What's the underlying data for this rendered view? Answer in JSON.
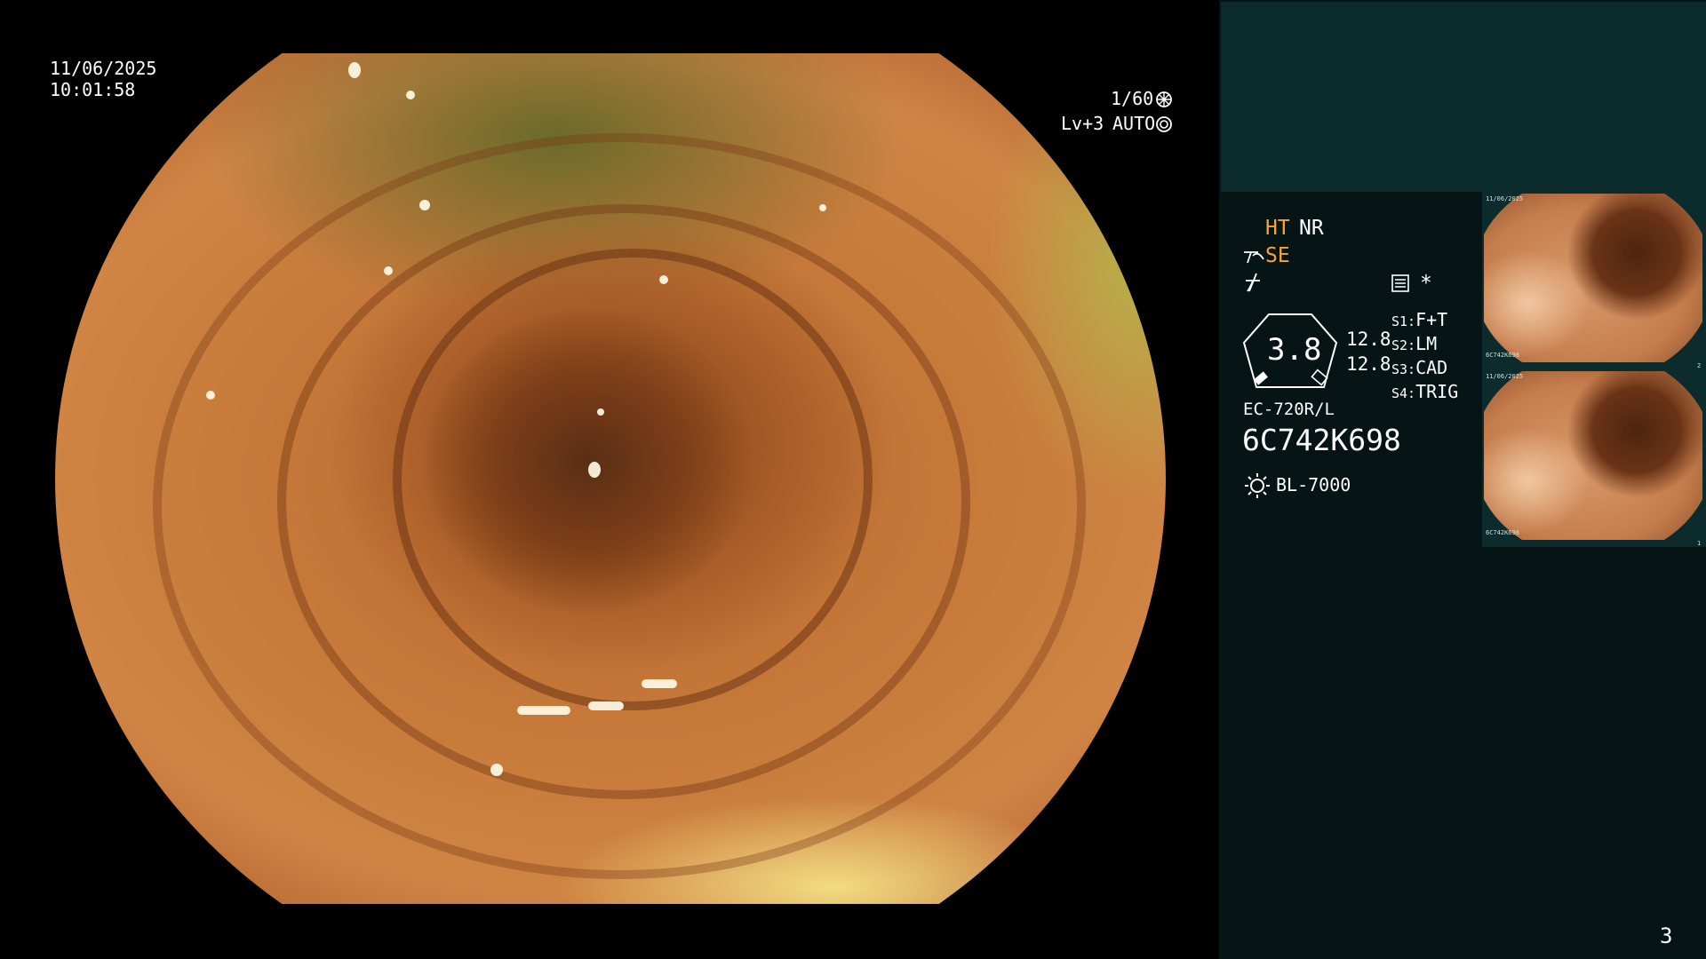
{
  "overlay": {
    "date": "11/06/2025",
    "time": "10:01:58",
    "shutter": "1/60",
    "level": "Lv+3",
    "iris": "AUTO"
  },
  "panel": {
    "ht": "HT",
    "nr": "NR",
    "se": "SE",
    "gauge_value": "3.8",
    "readout_a": "12.8",
    "readout_b": "12.8",
    "switches": [
      {
        "key": "S1:",
        "value": "F+T"
      },
      {
        "key": "S2:",
        "value": "LM"
      },
      {
        "key": "S3:",
        "value": "CAD"
      },
      {
        "key": "S4:",
        "value": "TRIG"
      }
    ],
    "scope_model": "EC-720R/L",
    "serial": "6C742K698",
    "light_source": "BL-7000",
    "asterisk": "*",
    "page_number": "3"
  },
  "thumbnails": [
    {
      "date": "11/06/2025",
      "serial": "6C742K698",
      "index": "2"
    },
    {
      "date": "11/06/2025",
      "serial": "6C742K698",
      "index": "1"
    }
  ],
  "colors": {
    "background": "#000000",
    "panel": "#071415",
    "panel_top": "#0b2b2c",
    "accent_orange": "#f6a72c",
    "text": "#ffffff"
  },
  "icons": [
    "shutter-icon",
    "iris-icon",
    "enhance-icon",
    "freeze-icon",
    "menu-icon",
    "light-icon"
  ]
}
